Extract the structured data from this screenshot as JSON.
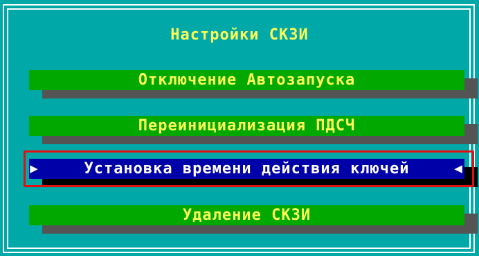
{
  "window": {
    "title": "Настройки СКЗИ"
  },
  "menu": {
    "items": [
      {
        "label": "Отключение Автозапуска"
      },
      {
        "label": "Переинициализация ПДСЧ"
      },
      {
        "label": "Установка времени действия ключей",
        "selected": true
      },
      {
        "label": "Удаление СКЗИ"
      }
    ],
    "selected_index": 2,
    "selection_markers": {
      "left": "▶",
      "right": "◀"
    }
  },
  "colors": {
    "background": "#00a8a8",
    "frame": "#ffffff",
    "item_face": "#00a800",
    "item_text": "#ffff55",
    "item_shadow": "#545454",
    "selected_face": "#0000a8",
    "selected_text": "#ffffff",
    "selected_shadow": "#000000",
    "highlight_annotation": "#e01010"
  },
  "icons": {
    "left_marker": "triangle-right-icon",
    "right_marker": "triangle-left-icon"
  }
}
